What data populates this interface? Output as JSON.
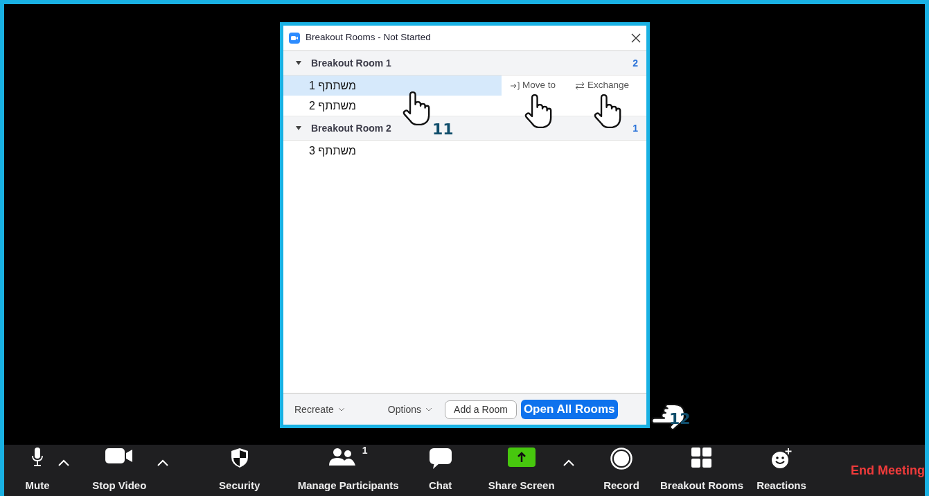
{
  "window": {
    "title": "Breakout Rooms - Not Started"
  },
  "rooms": [
    {
      "name": "Breakout Room 1",
      "count": "2",
      "expanded": true,
      "participants": [
        {
          "name": "משתתף 1",
          "selected": true,
          "actions": [
            "Move to",
            "Exchange"
          ]
        },
        {
          "name": "משתתף 2",
          "selected": false
        }
      ]
    },
    {
      "name": "Breakout Room 2",
      "count": "1",
      "expanded": true,
      "participants": [
        {
          "name": "משתתף 3",
          "selected": false
        }
      ]
    }
  ],
  "footer": {
    "recreate": "Recreate",
    "options": "Options",
    "add_room": "Add a Room",
    "open_all": "Open All Rooms"
  },
  "step_markers": [
    {
      "step": "11",
      "kind": "up"
    },
    {
      "step": "12",
      "kind": "left"
    }
  ],
  "toolbar": [
    {
      "kind": "mic",
      "label": "Mute"
    },
    {
      "kind": "caret"
    },
    {
      "kind": "video",
      "label": "Stop Video"
    },
    {
      "kind": "caret"
    },
    {
      "kind": "shield",
      "label": "Security"
    },
    {
      "kind": "people",
      "label": "Manage Participants",
      "count": "1"
    },
    {
      "kind": "chat",
      "label": "Chat"
    },
    {
      "kind": "share",
      "label": "Share Screen"
    },
    {
      "kind": "caret"
    },
    {
      "kind": "record",
      "label": "Record"
    },
    {
      "kind": "grid",
      "label": "Breakout Rooms"
    },
    {
      "kind": "smile",
      "label": "Reactions"
    },
    {
      "kind": "end",
      "label": "End Meeting"
    }
  ]
}
